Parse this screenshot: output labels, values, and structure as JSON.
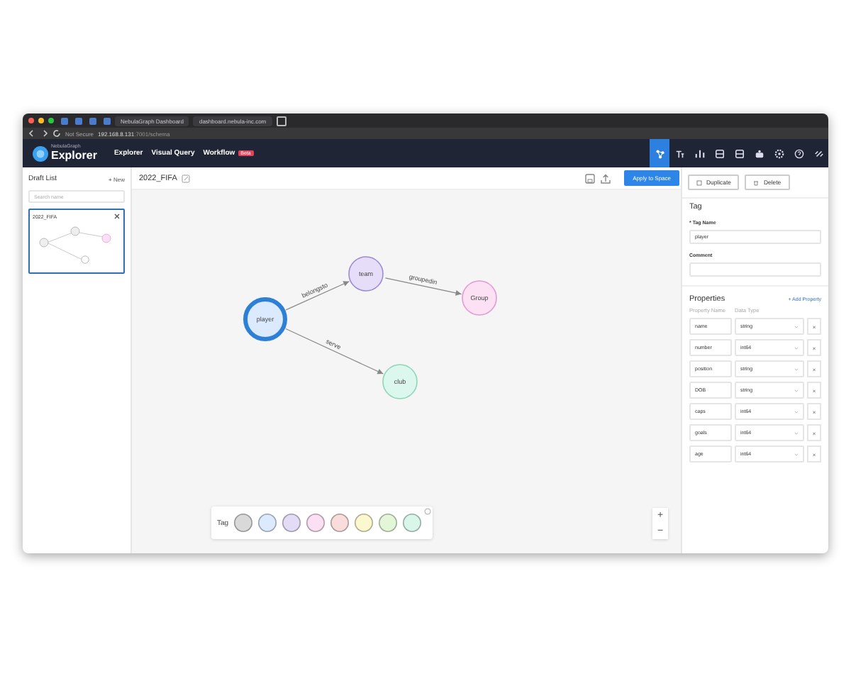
{
  "browser": {
    "tabs": [
      {
        "title": "NebulaGraph Dashboard",
        "selected": false
      },
      {
        "title": "dashboard.nebula-inc.com",
        "selected": false
      }
    ],
    "address": {
      "security": "Not Secure",
      "url": "192.168.8.131",
      "path": ":7001/schema"
    }
  },
  "app": {
    "brand": "NebulaGraph",
    "product": "Explorer",
    "nav": [
      {
        "label": "Explorer"
      },
      {
        "label": "Visual Query"
      },
      {
        "label": "Workflow",
        "badge": "Beta"
      }
    ],
    "toolbar": [
      {
        "selected": true
      },
      {
        "selected": false
      },
      {
        "selected": false
      },
      {
        "selected": false
      },
      {
        "selected": false
      },
      {
        "selected": false
      },
      {
        "selected": false
      },
      {
        "selected": false
      },
      {
        "selected": false
      }
    ]
  },
  "drafts": {
    "title": "Draft List",
    "new_button": "+ New",
    "search": {
      "placeholder": "Search name"
    },
    "items": [
      {
        "name": "2022_FIFA",
        "selected": true
      }
    ]
  },
  "editor": {
    "title": "2022_FIFA",
    "apply_button": "Apply to Space"
  },
  "graph": {
    "nodes": [
      {
        "label": "player",
        "color": "#dbeafe",
        "selected": true
      },
      {
        "label": "team",
        "color": "#e6def8",
        "selected": false
      },
      {
        "label": "Group",
        "color": "#fbe1f3",
        "selected": false
      },
      {
        "label": "club",
        "color": "#dcf7ee",
        "selected": false
      }
    ],
    "edges": [
      {
        "label": "belongsto"
      },
      {
        "label": "groupedin"
      },
      {
        "label": "serve"
      }
    ]
  },
  "palette": {
    "label": "Tag",
    "swatches": [
      {
        "color": "#d9d9d9"
      },
      {
        "color": "#dbeafe"
      },
      {
        "color": "#e3dcf7"
      },
      {
        "color": "#fbe0f3"
      },
      {
        "color": "#fadcdc"
      },
      {
        "color": "#fbf7cf"
      },
      {
        "color": "#e4f6d8"
      },
      {
        "color": "#d8f6ea"
      }
    ]
  },
  "zoom": {
    "in": "+",
    "out": "−"
  },
  "inspector": {
    "duplicate": "Duplicate",
    "delete": "Delete",
    "section": "Tag",
    "name_label": "* Tag Name",
    "name_value": "player",
    "comment_label": "Comment",
    "properties_title": "Properties",
    "add_property": "+ Add Property",
    "columns": [
      "Property Name",
      "Data Type"
    ],
    "properties": [
      {
        "name": "name",
        "type": "string"
      },
      {
        "name": "number",
        "type": "int64"
      },
      {
        "name": "position",
        "type": "string"
      },
      {
        "name": "DOB",
        "type": "string"
      },
      {
        "name": "caps",
        "type": "int64"
      },
      {
        "name": "goals",
        "type": "int64"
      },
      {
        "name": "age",
        "type": "int64"
      }
    ],
    "remove": "×"
  }
}
